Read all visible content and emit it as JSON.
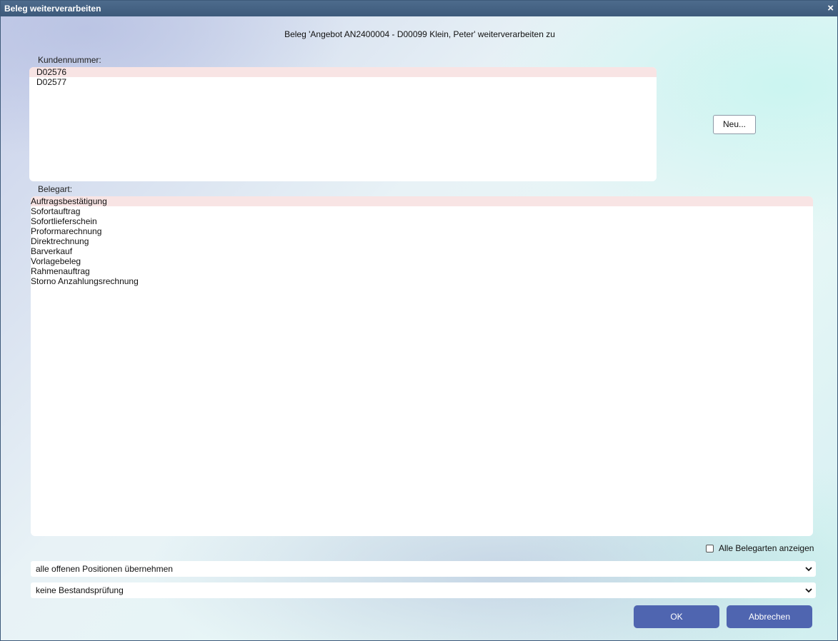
{
  "dialog": {
    "title": "Beleg weiterverarbeiten",
    "close_glyph": "×",
    "header": "Beleg 'Angebot AN2400004 - D00099 Klein, Peter' weiterverarbeiten zu"
  },
  "customer": {
    "label": "Kundennummer:",
    "items": [
      "D02576",
      "D02577"
    ],
    "selected_index": 0,
    "new_button": "Neu..."
  },
  "doctype": {
    "label": "Belegart:",
    "items": [
      "Auftragsbestätigung",
      "Sofortauftrag",
      "Sofortlieferschein",
      "Proformarechnung",
      "Direktrechnung",
      "Barverkauf",
      "Vorlagebeleg",
      "Rahmenauftrag",
      "Storno Anzahlungsrechnung"
    ],
    "selected_index": 0
  },
  "options": {
    "show_all_label": "Alle Belegarten anzeigen",
    "show_all_checked": false,
    "positions_select": "alle offenen Positionen übernehmen",
    "stock_select": "keine Bestandsprüfung"
  },
  "buttons": {
    "ok": "OK",
    "cancel": "Abbrechen"
  },
  "icons": {
    "close": "close-icon",
    "dropdown": "chevron-down-icon"
  },
  "colors": {
    "titlebar": "#3d5a7b",
    "selection": "#f8e4e4",
    "primary_button": "#4f65b0"
  }
}
